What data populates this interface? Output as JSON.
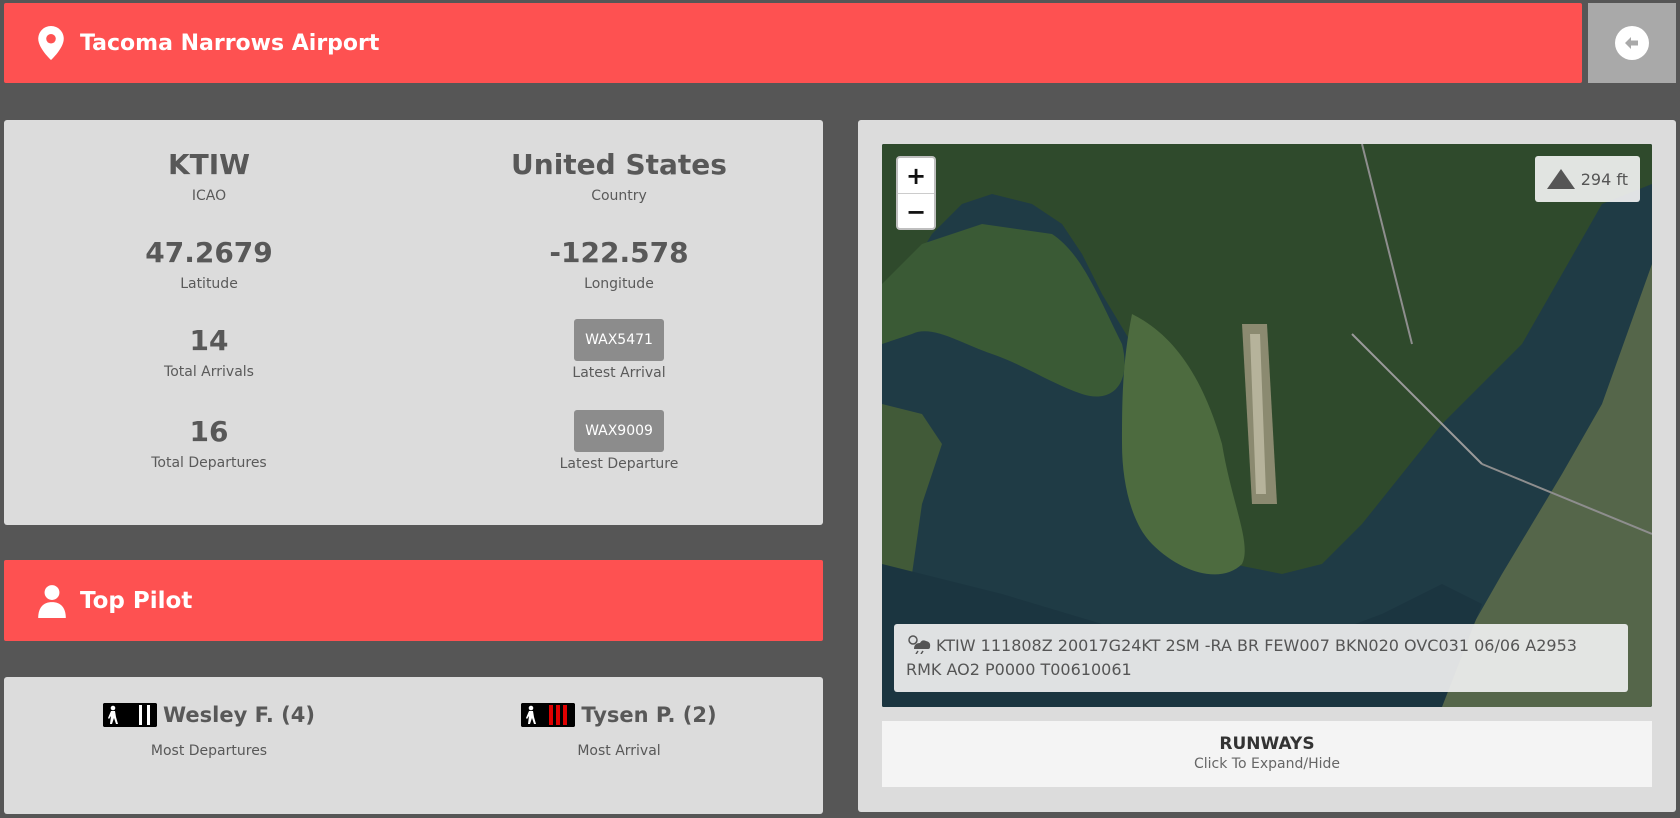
{
  "header": {
    "title": "Tacoma Narrows Airport",
    "icon": "map-pin-icon"
  },
  "back_button": {
    "icon": "arrow-left-circle-icon"
  },
  "info": {
    "icao": {
      "value": "KTIW",
      "label": "ICAO"
    },
    "country": {
      "value": "United States",
      "label": "Country"
    },
    "latitude": {
      "value": "47.2679",
      "label": "Latitude"
    },
    "longitude": {
      "value": "-122.578",
      "label": "Longitude"
    },
    "total_arrivals": {
      "value": "14",
      "label": "Total Arrivals"
    },
    "latest_arrival": {
      "value": "WAX5471",
      "label": "Latest Arrival"
    },
    "total_departures": {
      "value": "16",
      "label": "Total Departures"
    },
    "latest_departure": {
      "value": "WAX9009",
      "label": "Latest Departure"
    }
  },
  "top_pilot": {
    "title": "Top Pilot",
    "icon": "person-icon",
    "pilots": [
      {
        "name": "Wesley F. (4)",
        "label": "Most Departures",
        "rank_stripe_color": "#ffffff"
      },
      {
        "name": "Tysen P. (2)",
        "label": "Most Arrival",
        "rank_stripe_color": "#e00000"
      }
    ]
  },
  "map": {
    "zoom_in": "+",
    "zoom_out": "−",
    "elevation": "294 ft",
    "metar": "KTIW 111808Z 20017G24KT 2SM -RA BR FEW007 BKN020 OVC031 06/06 A2953 RMK AO2 P0000 T00610061",
    "metar_icon": "cloud-sun-rain-icon"
  },
  "runways": {
    "title": "RUNWAYS",
    "subtitle": "Click To Expand/Hide"
  },
  "colors": {
    "accent": "#fe5151",
    "background": "#565656",
    "panel": "#dcdcdc"
  }
}
